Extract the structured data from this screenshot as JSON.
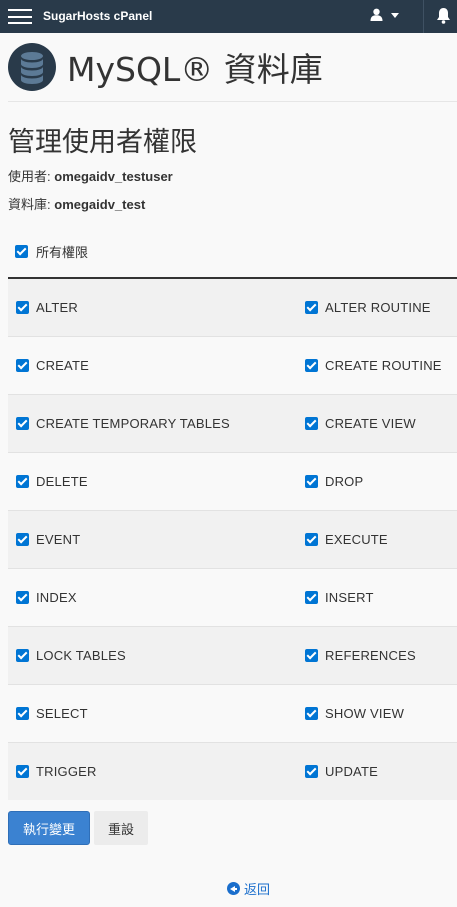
{
  "topbar": {
    "brand": "SugarHosts cPanel",
    "icons": [
      "hamburger-icon",
      "user-icon",
      "caret-down-icon",
      "bell-icon"
    ]
  },
  "header": {
    "title": "MySQL® 資料庫",
    "icon": "database-icon"
  },
  "section": {
    "title": "管理使用者權限",
    "user_label": "使用者:",
    "user_value": "omegaidv_testuser",
    "db_label": "資料庫:",
    "db_value": "omegaidv_test"
  },
  "all_privileges": {
    "label": "所有權限",
    "checked": true
  },
  "privileges": [
    {
      "left": "ALTER",
      "right": "ALTER ROUTINE"
    },
    {
      "left": "CREATE",
      "right": "CREATE ROUTINE"
    },
    {
      "left": "CREATE TEMPORARY TABLES",
      "right": "CREATE VIEW"
    },
    {
      "left": "DELETE",
      "right": "DROP"
    },
    {
      "left": "EVENT",
      "right": "EXECUTE"
    },
    {
      "left": "INDEX",
      "right": "INSERT"
    },
    {
      "left": "LOCK TABLES",
      "right": "REFERENCES"
    },
    {
      "left": "SELECT",
      "right": "SHOW VIEW"
    },
    {
      "left": "TRIGGER",
      "right": "UPDATE"
    }
  ],
  "buttons": {
    "apply": "執行變更",
    "reset": "重設"
  },
  "back_link": "返回",
  "colors": {
    "topbar": "#293a4a",
    "primary": "#3b82d1",
    "checkbox": "#0075d4",
    "link": "#1a6ecc"
  }
}
